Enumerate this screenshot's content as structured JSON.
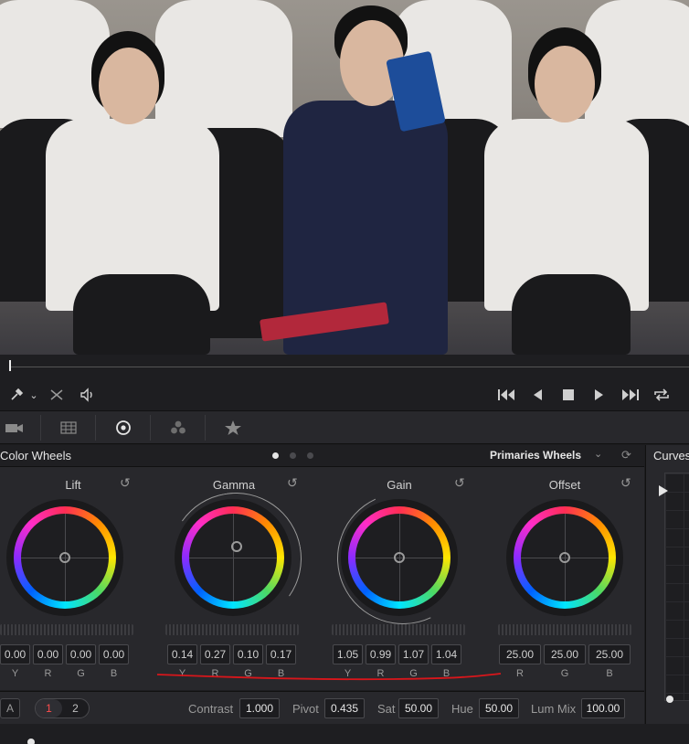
{
  "panel": {
    "title": "Color Wheels",
    "mode": "Primaries Wheels",
    "page_dots": 3,
    "active_dot": 0
  },
  "wheels": [
    {
      "name": "Lift",
      "values": [
        "0.00",
        "0.00",
        "0.00",
        "0.00"
      ],
      "channels": [
        "Y",
        "R",
        "G",
        "B"
      ]
    },
    {
      "name": "Gamma",
      "values": [
        "0.14",
        "0.27",
        "0.10",
        "0.17"
      ],
      "channels": [
        "Y",
        "R",
        "G",
        "B"
      ]
    },
    {
      "name": "Gain",
      "values": [
        "1.05",
        "0.99",
        "1.07",
        "1.04"
      ],
      "channels": [
        "Y",
        "R",
        "G",
        "B"
      ]
    },
    {
      "name": "Offset",
      "values": [
        "25.00",
        "25.00",
        "25.00"
      ],
      "channels": [
        "R",
        "G",
        "B"
      ]
    }
  ],
  "adjust": {
    "a_button": "A",
    "page1": "1",
    "page2": "2",
    "contrast_label": "Contrast",
    "contrast": "1.000",
    "pivot_label": "Pivot",
    "pivot": "0.435",
    "sat_label": "Sat",
    "sat": "50.00",
    "hue_label": "Hue",
    "hue": "50.00",
    "lummix_label": "Lum Mix",
    "lummix": "100.00"
  },
  "curves": {
    "title": "Curves"
  },
  "icons": {
    "picker": "eyedropper-icon",
    "picker_chev": "chevron-down-icon",
    "bypass": "crossed-arrows-icon",
    "audio": "speaker-icon",
    "first": "skip-to-start-icon",
    "prev": "play-reverse-icon",
    "stop": "stop-icon",
    "play": "play-icon",
    "last": "skip-to-end-icon",
    "loop": "loop-icon"
  },
  "colors": {
    "accent_red": "#ff4d4d",
    "annotation_red": "#d8161b",
    "panel_bg": "#28282c"
  }
}
